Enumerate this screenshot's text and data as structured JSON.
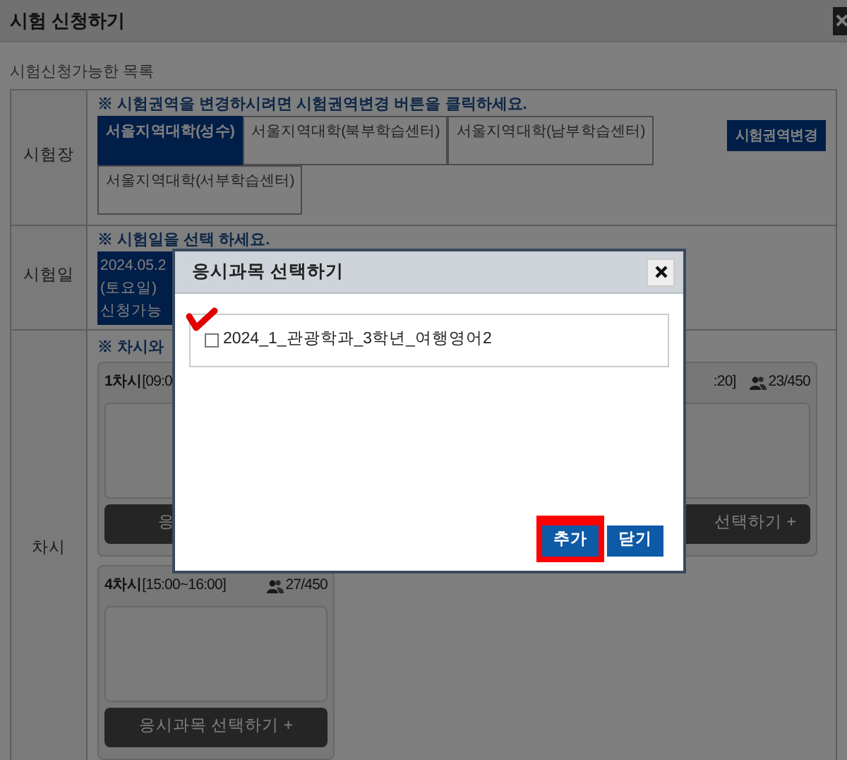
{
  "dialog": {
    "title": "시험 신청하기",
    "section_label": "시험신청가능한 목록",
    "venue": {
      "label": "시험장",
      "notice": "※ 시험권역을 변경하시려면 시험권역변경 버튼을 클릭하세요.",
      "change_button": "시험권역변경",
      "options": [
        {
          "label": "서울지역대학(성수)",
          "selected": true
        },
        {
          "label": "서울지역대학(북부학습센터)",
          "selected": false
        },
        {
          "label": "서울지역대학(남부학습센터)",
          "selected": false
        },
        {
          "label": "서울지역대학(서부학습센터)",
          "selected": false
        }
      ]
    },
    "date": {
      "label": "시험일",
      "notice": "※ 시험일을 선택 하세요.",
      "options": [
        {
          "lines": [
            "2024.05.2",
            "(토요일)",
            "신청가능"
          ],
          "selected": true
        }
      ]
    },
    "session": {
      "label": "차시",
      "notice": "※ 차시와",
      "cards": [
        {
          "kind": "wide",
          "title": "1차시",
          "time": "[09:0",
          "time_end": ":20]",
          "count": "23/450",
          "button_left": "응",
          "button_right": "선택하기 +"
        },
        {
          "kind": "full",
          "title": "4차시",
          "time": "[15:00~16:00]",
          "count": "27/450",
          "button": "응시과목 선택하기 +"
        }
      ]
    }
  },
  "modal": {
    "title": "응시과목 선택하기",
    "subjects": [
      {
        "label": "2024_1_관광학과_3학년_여행영어2",
        "checked": false,
        "annotated": true
      }
    ],
    "buttons": [
      {
        "label": "추가",
        "highlighted": true
      },
      {
        "label": "닫기",
        "highlighted": false
      }
    ]
  }
}
